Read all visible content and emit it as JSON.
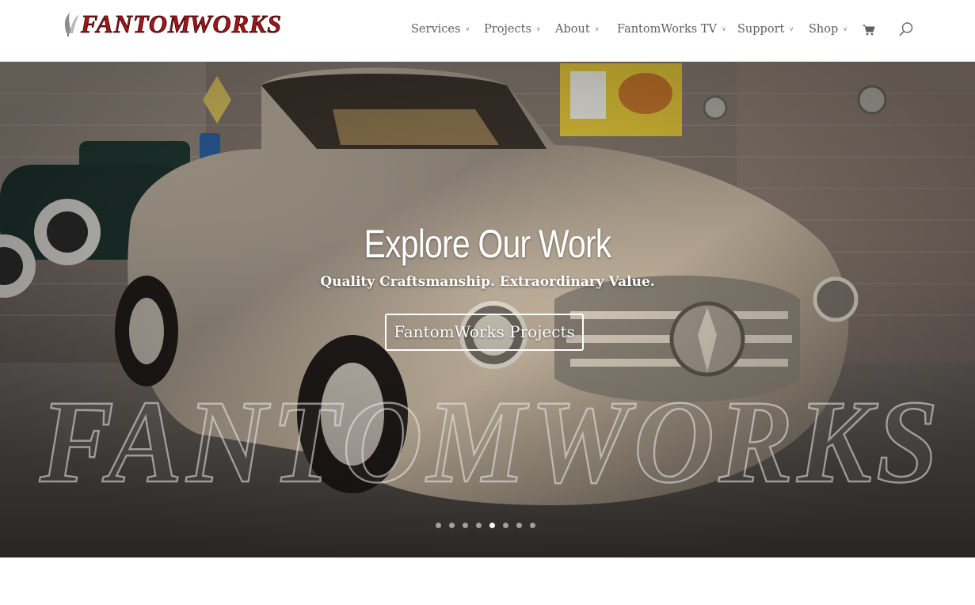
{
  "brand": {
    "logo_text": "FantomWorks",
    "logo_color": "#a3161b"
  },
  "nav": {
    "items": [
      {
        "label": "Services"
      },
      {
        "label": "Projects"
      },
      {
        "label": "About"
      },
      {
        "label": "FantomWorks TV"
      },
      {
        "label": "Support"
      },
      {
        "label": "Shop"
      }
    ],
    "cart_icon": "cart-icon",
    "search_icon": "search-icon"
  },
  "hero": {
    "title": "Explore Our Work",
    "subtitle": "Quality Craftsmanship.  Extraordinary Value.",
    "button_label": "FantomWorks Projects",
    "watermark_text": "FantomWorks",
    "slider": {
      "count": 8,
      "active_index": 4
    }
  },
  "colors": {
    "nav_text": "#5f5f5f",
    "accent_red": "#a3161b",
    "hero_text": "#ffffff"
  }
}
